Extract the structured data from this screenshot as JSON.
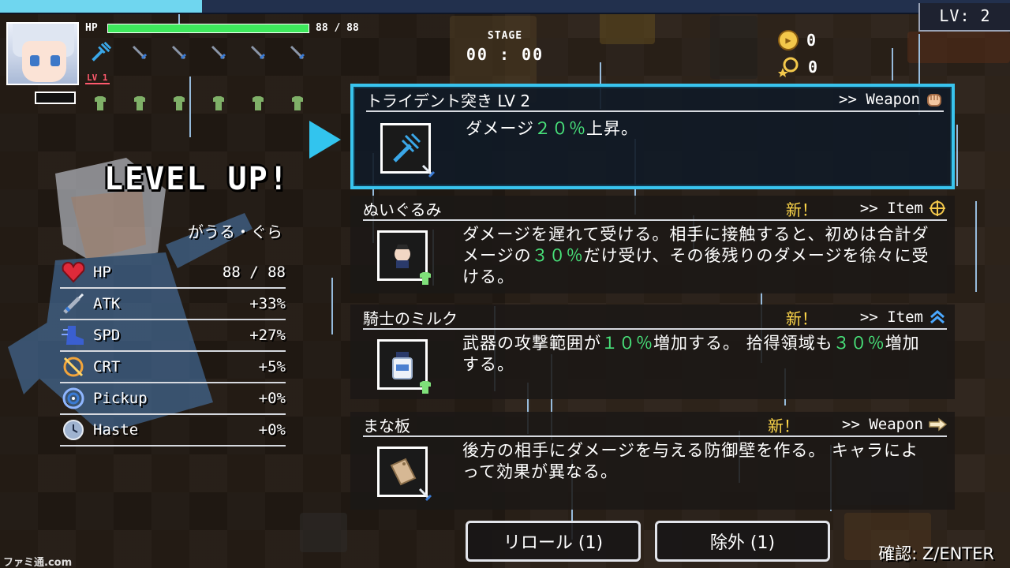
{
  "hud": {
    "level": "LV: 2",
    "hp_label": "HP",
    "hp_text": "88 / 88",
    "hp_fraction": 1.0,
    "stage_progress": 0.2,
    "weapon_level_tag": "LV 1",
    "stage_label": "STAGE",
    "stage_time": "00 : 00",
    "coins": "0",
    "kills": "0"
  },
  "levelup": {
    "title": "LEVEL UP!",
    "character_name": "がうる・ぐら",
    "stats": [
      {
        "name": "HP",
        "value": "88 / 88",
        "icon": "heart-icon"
      },
      {
        "name": "ATK",
        "value": "+33%",
        "icon": "sword-icon"
      },
      {
        "name": "SPD",
        "value": "+27%",
        "icon": "boot-icon"
      },
      {
        "name": "CRT",
        "value": "+5%",
        "icon": "crit-icon"
      },
      {
        "name": "Pickup",
        "value": "+0%",
        "icon": "target-icon"
      },
      {
        "name": "Haste",
        "value": "+0%",
        "icon": "clock-icon"
      }
    ]
  },
  "cards": [
    {
      "title": "トライデント突き LV 2",
      "new": "",
      "type": ">> Weapon",
      "type_icon": "fist-icon",
      "icon": "trident-icon",
      "desc_parts": [
        [
          "ダメージ",
          ""
        ],
        [
          "２０％",
          "hl"
        ],
        [
          "上昇。",
          ""
        ]
      ]
    },
    {
      "title": "ぬいぐるみ",
      "new": "新！",
      "type": ">> Item",
      "type_icon": "crosshair-icon",
      "icon": "plushie-icon",
      "desc_parts": [
        [
          "ダメージを遅れて受ける。相手に接触すると、初めは合計ダメージの",
          ""
        ],
        [
          "３０％",
          "hl"
        ],
        [
          "だけ受け、その後残りのダメージを徐々に受ける。",
          ""
        ]
      ]
    },
    {
      "title": "騎士のミルク",
      "new": "新！",
      "type": ">> Item",
      "type_icon": "double-chevron-up-icon",
      "icon": "milk-icon",
      "desc_parts": [
        [
          "武器の攻撃範囲が",
          ""
        ],
        [
          "１０％",
          "hl"
        ],
        [
          "増加する。 拾得領域も",
          ""
        ],
        [
          "３０％",
          "hl"
        ],
        [
          "増加する。",
          ""
        ]
      ]
    },
    {
      "title": "まな板",
      "new": "新！",
      "type": ">> Weapon",
      "type_icon": "pointing-hand-icon",
      "icon": "cutting-board-icon",
      "desc_parts": [
        [
          "後方の相手にダメージを与える防御壁を作る。 キャラによって効果が異なる。",
          ""
        ]
      ]
    }
  ],
  "buttons": {
    "reroll": "リロール (1)",
    "eliminate": "除外 (1)"
  },
  "confirm_hint": "確認: Z/ENTER",
  "watermark": "ファミ通.com"
}
